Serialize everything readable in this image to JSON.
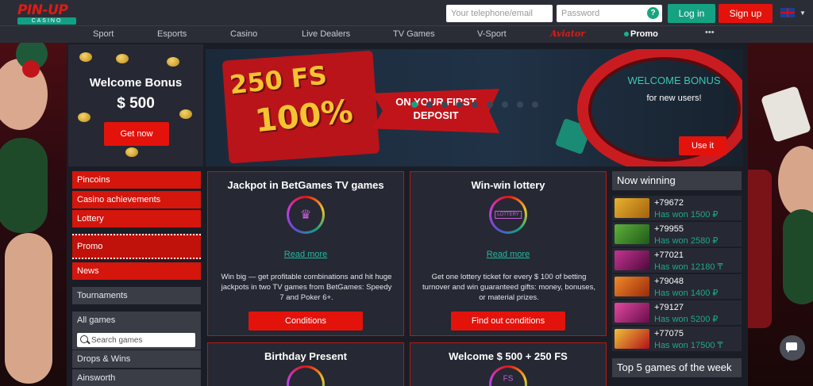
{
  "brand": {
    "logo_text": "PIN-UP",
    "logo_sub": "CASINO"
  },
  "header": {
    "phone_placeholder": "Your telephone/email",
    "password_placeholder": "Password",
    "help_glyph": "?",
    "login_label": "Log in",
    "signup_label": "Sign up",
    "language_flag": "uk-flag-icon",
    "colors": {
      "login": "#14a283",
      "signup": "#e3130c"
    }
  },
  "nav": {
    "items": [
      "Sport",
      "Esports",
      "Casino",
      "Live Dealers",
      "TV Games",
      "V-Sport"
    ],
    "aviator": "Aviator",
    "promo": "Promo",
    "more": "•••"
  },
  "welcome": {
    "title": "Welcome Bonus",
    "amount": "$ 500",
    "button": "Get now"
  },
  "banner": {
    "fs": "250 FS",
    "percent": "100%",
    "first_deposit": "ON YOUR FIRST DEPOSIT",
    "welcome_bonus": "WELCOME BONUS",
    "new_users": "for new users!",
    "button": "Use it",
    "slide_count": 9,
    "active_slide": 1
  },
  "menu": {
    "red_items": [
      "Pincoins",
      "Casino achievements",
      "Lottery",
      "Promo",
      "News"
    ],
    "tournaments": "Tournaments",
    "all_games": "All games",
    "search_placeholder": "Search games",
    "providers": [
      "Drops & Wins",
      "Ainsworth"
    ]
  },
  "cards": [
    {
      "title": "Jackpot in BetGames TV games",
      "icon": "crown-icon",
      "link": "Read more",
      "desc": "Win big — get profitable combinations and hit huge jackpots in two TV games from BetGames: Speedy 7 and Poker 6+.",
      "button": "Conditions"
    },
    {
      "title": "Win-win lottery",
      "icon": "lottery-ticket-icon",
      "icon_text": "LOTTERY",
      "link": "Read more",
      "desc": "Get one lottery ticket for every $ 100 of betting turnover and win guaranteed gifts: money, bonuses, or material prizes.",
      "button": "Find out conditions"
    },
    {
      "title": "Birthday Present",
      "icon": "gift-icon"
    },
    {
      "title": "Welcome $ 500 + 250 FS",
      "icon": "fs-icon",
      "icon_text": "FS"
    }
  ],
  "now_winning": {
    "title": "Now winning",
    "rows": [
      {
        "phone": "+79672",
        "amount": "Has won 1500 ₽",
        "thumb": "#c98a1c"
      },
      {
        "phone": "+79955",
        "amount": "Has won 2580 ₽",
        "thumb": "#3b8a2a"
      },
      {
        "phone": "+77021",
        "amount": "Has won 12180 ₸",
        "thumb": "#8d1c6c"
      },
      {
        "phone": "+79048",
        "amount": "Has won 1400 ₽",
        "thumb": "#d35a17"
      },
      {
        "phone": "+79127",
        "amount": "Has won 5200 ₽",
        "thumb": "#b0197a"
      },
      {
        "phone": "+77075",
        "amount": "Has won 17500 ₸",
        "thumb": "#c8171e"
      }
    ]
  },
  "top5": {
    "title": "Top 5 games of the week"
  },
  "chat": {
    "icon": "chat-icon"
  }
}
